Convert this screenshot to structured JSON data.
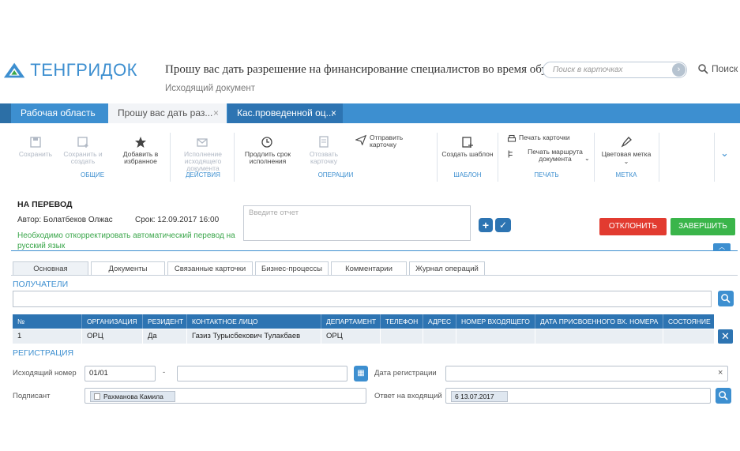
{
  "app": {
    "name": "ТЕНГРИДОК"
  },
  "header": {
    "title": "Прошу вас дать разрешение на финансирование специалистов во время обучен...",
    "subtitle": "Исходящий документ",
    "search_placeholder": "Поиск в карточках",
    "search_label": "Поиск"
  },
  "tabs": [
    {
      "label": "Рабочая область",
      "active": false
    },
    {
      "label": "Прошу вас дать раз...",
      "active": true,
      "close": "×"
    },
    {
      "label": "Кас.проведенной оц...",
      "active": false,
      "close": "×"
    }
  ],
  "ribbon": {
    "save": "Сохранить",
    "save_create": "Сохранить и создать",
    "favorite": "Добавить в избранное",
    "group_general": "ОБЩИЕ",
    "execute": "Исполнение исходящего документа",
    "group_actions": "ДЕЙСТВИЯ",
    "extend": "Продлить срок исполнения",
    "revoke": "Отозвать карточку",
    "send": "Отправить карточку",
    "group_operations": "ОПЕРАЦИИ",
    "create_template": "Создать шаблон",
    "group_template": "ШАБЛОН",
    "print_card": "Печать карточки",
    "print_route": "Печать маршрута документа",
    "group_print": "ПЕЧАТЬ",
    "color_mark": "Цветовая метка",
    "group_mark": "МЕТКА"
  },
  "task": {
    "title": "НА ПЕРЕВОД",
    "author": "Автор: Болатбеков Олжас",
    "deadline": "Срок: 12.09.2017 16:00",
    "note": "Необходимо откорректировать автоматический перевод на русский язык",
    "report_placeholder": "Введите отчет",
    "reject": "ОТКЛОНИТЬ",
    "finish": "ЗАВЕРШИТЬ"
  },
  "doc_tabs": [
    "Основная",
    "Документы",
    "Связанные карточки",
    "Бизнес-процессы",
    "Комментарии",
    "Журнал операций"
  ],
  "recipients": {
    "section": "ПОЛУЧАТЕЛИ",
    "columns": [
      "№",
      "ОРГАНИЗАЦИЯ",
      "РЕЗИДЕНТ",
      "КОНТАКТНОЕ ЛИЦО",
      "ДЕПАРТАМЕНТ",
      "ТЕЛЕФОН",
      "АДРЕС",
      "НОМЕР ВХОДЯЩЕГО",
      "ДАТА ПРИСВОЕННОГО ВХ. НОМЕРА",
      "СОСТОЯНИЕ"
    ],
    "rows": [
      [
        "1",
        "ОРЦ",
        "Да",
        "Газиз Турысбекович Тулакбаев",
        "ОРЦ",
        "",
        "",
        "",
        "",
        ""
      ]
    ]
  },
  "registration": {
    "section": "РЕГИСТРАЦИЯ",
    "out_number_label": "Исходящий номер",
    "out_number_value": "01/01",
    "dash": "-",
    "reg_date_label": "Дата регистрации",
    "signer_label": "Подписант",
    "signer_value": "Рахманова Камила",
    "reply_label": "Ответ на входящий",
    "reply_value": "6 13.07.2017",
    "clear": "×"
  },
  "colors": {
    "accent": "#3d8fd0",
    "dark_accent": "#2d74b2",
    "reject": "#e23b30",
    "finish": "#3ab54a"
  }
}
